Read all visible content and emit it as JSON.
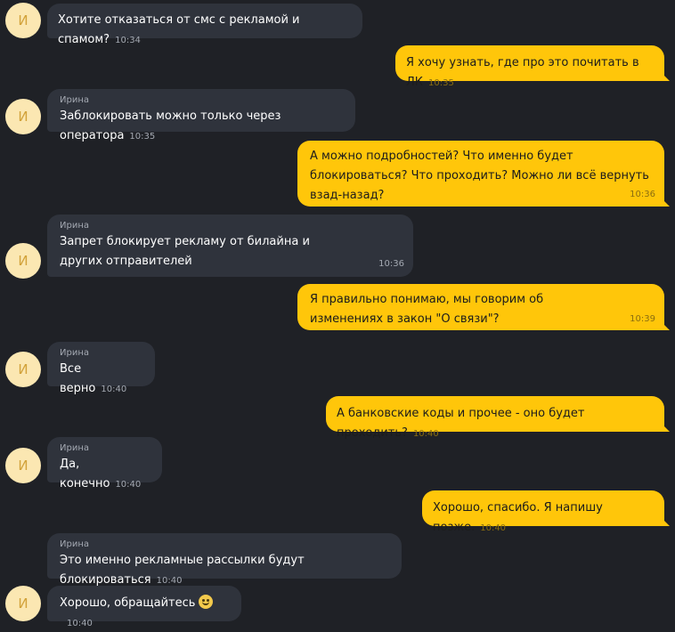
{
  "chat": {
    "avatar_letter": "И",
    "messages": [
      {
        "direction": "in",
        "sender": "",
        "text": "Хотите отказаться от смс с рекламой и спамом?",
        "time": "10:34"
      },
      {
        "direction": "out",
        "text": "Я хочу узнать, где про это почитать в ЛК",
        "time": "10:35"
      },
      {
        "direction": "in",
        "sender": "Ирина",
        "text": "Заблокировать можно только через оператора",
        "time": "10:35"
      },
      {
        "direction": "out",
        "text": "А можно подробностей? Что именно будет блокироваться? Что проходить? Можно ли всё вернуть взад-назад?",
        "time": "10:36"
      },
      {
        "direction": "in",
        "sender": "Ирина",
        "text": "Запрет блокирует рекламу от билайна и других отправителей",
        "time": "10:36"
      },
      {
        "direction": "out",
        "text": "Я правильно понимаю, мы говорим об изменениях в закон \"О связи\"?",
        "time": "10:39"
      },
      {
        "direction": "in",
        "sender": "Ирина",
        "text": "Все верно",
        "time": "10:40"
      },
      {
        "direction": "out",
        "text": "А банковские коды и прочее - оно будет проходить?",
        "time": "10:40"
      },
      {
        "direction": "in",
        "sender": "Ирина",
        "text": "Да, конечно",
        "time": "10:40"
      },
      {
        "direction": "out",
        "text": "Хорошо, спасибо. Я напишу позже.",
        "time": "10:40"
      },
      {
        "direction": "in",
        "sender": "Ирина",
        "text": "Это именно рекламные рассылки будут блокироваться",
        "time": "10:40"
      },
      {
        "direction": "in",
        "sender": "",
        "text": "Хорошо, обращайтесь",
        "time": "10:40",
        "emoji": "smiling-face-emoji"
      }
    ]
  },
  "colors": {
    "background": "#1f2126",
    "incoming_bubble": "#2f333c",
    "outgoing_bubble": "#ffc60a",
    "avatar_bg": "#fbe7b2",
    "avatar_letter": "#d2a23a"
  }
}
